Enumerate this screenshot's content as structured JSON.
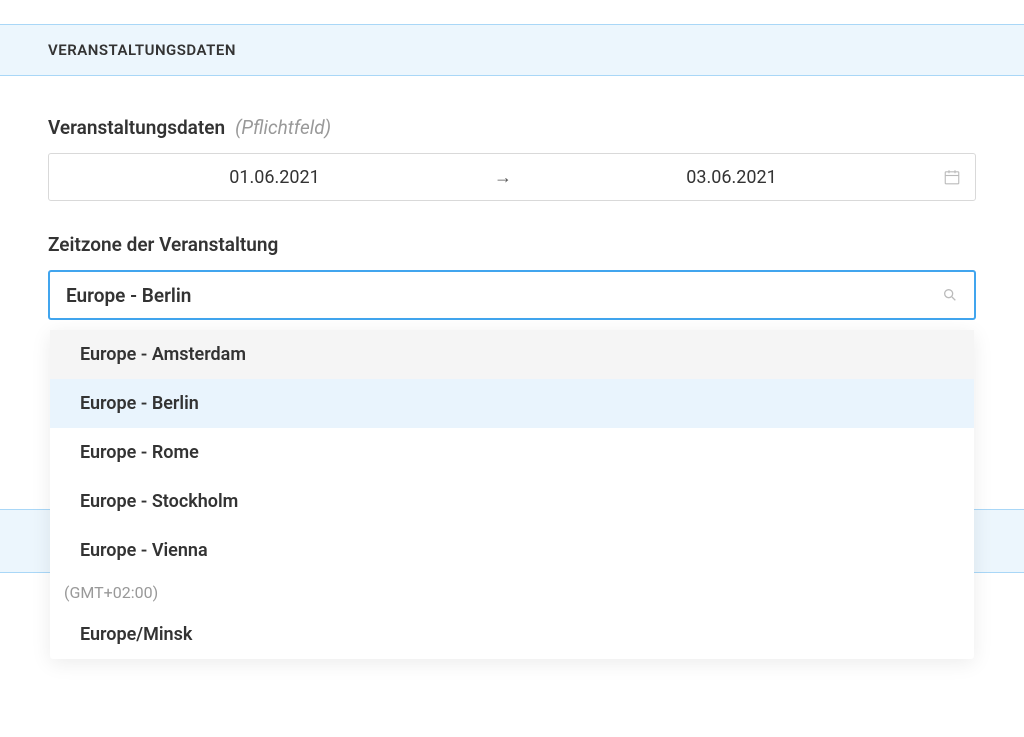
{
  "section": {
    "title": "VERANSTALTUNGSDATEN"
  },
  "dates": {
    "label": "Veranstaltungsdaten",
    "hint": "(Pflichtfeld)",
    "start": "01.06.2021",
    "end": "03.06.2021",
    "arrow": "→"
  },
  "timezone": {
    "label": "Zeitzone der Veranstaltung",
    "selected": "Europe - Berlin",
    "options": [
      {
        "label": "Europe - Amsterdam",
        "state": "hover"
      },
      {
        "label": "Europe - Berlin",
        "state": "selected"
      },
      {
        "label": "Europe - Rome",
        "state": ""
      },
      {
        "label": "Europe - Stockholm",
        "state": ""
      },
      {
        "label": "Europe - Vienna",
        "state": ""
      }
    ],
    "group": "(GMT+02:00)",
    "options2": [
      {
        "label": "Europe/Minsk",
        "state": ""
      }
    ]
  }
}
